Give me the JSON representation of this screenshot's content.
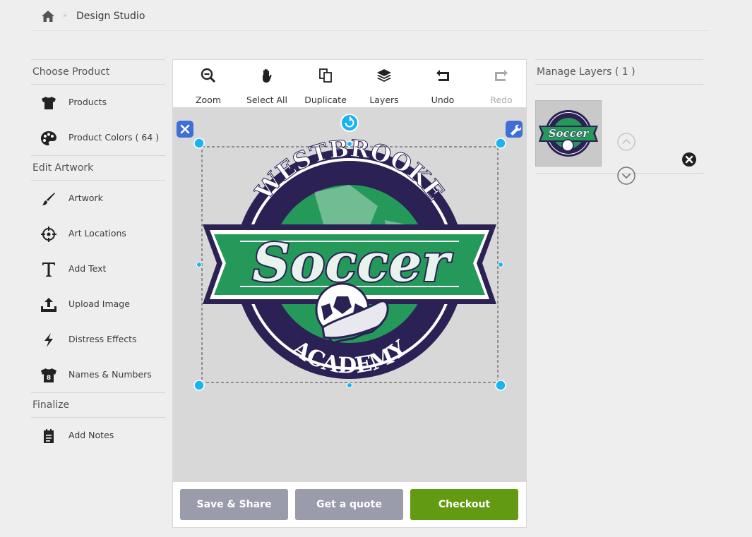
{
  "breadcrumb": {
    "title": "Design Studio",
    "separator": "»"
  },
  "sidebar": {
    "sections": [
      {
        "title": "Choose Product",
        "items": [
          {
            "label": "Products",
            "icon": "tshirt-icon"
          },
          {
            "label": "Product Colors ( 64 )",
            "icon": "palette-icon"
          }
        ]
      },
      {
        "title": "Edit Artwork",
        "items": [
          {
            "label": "Artwork",
            "icon": "brush-icon"
          },
          {
            "label": "Art Locations",
            "icon": "crosshair-icon"
          },
          {
            "label": "Add Text",
            "icon": "text-icon"
          },
          {
            "label": "Upload Image",
            "icon": "upload-icon"
          },
          {
            "label": "Distress Effects",
            "icon": "lightning-icon"
          },
          {
            "label": "Names & Numbers",
            "icon": "jersey-number-icon"
          }
        ]
      },
      {
        "title": "Finalize",
        "items": [
          {
            "label": "Add Notes",
            "icon": "notes-icon"
          }
        ]
      }
    ]
  },
  "toolbar": {
    "tools": [
      {
        "label": "Zoom",
        "icon": "zoom-out-icon"
      },
      {
        "label": "Select All",
        "icon": "hand-icon"
      },
      {
        "label": "Duplicate",
        "icon": "duplicate-icon"
      },
      {
        "label": "Layers",
        "icon": "layers-icon"
      },
      {
        "label": "Undo",
        "icon": "undo-icon"
      },
      {
        "label": "Redo",
        "icon": "redo-icon"
      }
    ]
  },
  "artwork": {
    "top_text": "WESTBROOKE",
    "script_text": "Soccer",
    "bottom_text": "ACADEMY",
    "colors": {
      "navy": "#2b2154",
      "green": "#25995a",
      "white": "#ffffff"
    }
  },
  "actions": {
    "save_share": "Save & Share",
    "get_quote": "Get a quote",
    "checkout": "Checkout"
  },
  "layers": {
    "title": "Manage Layers ( 1 )"
  },
  "colors": {
    "accent_green": "#629a12",
    "button_grey": "#9b9cab",
    "handle_cyan": "#1ab2f0",
    "handle_blue": "#3f6fd6"
  }
}
